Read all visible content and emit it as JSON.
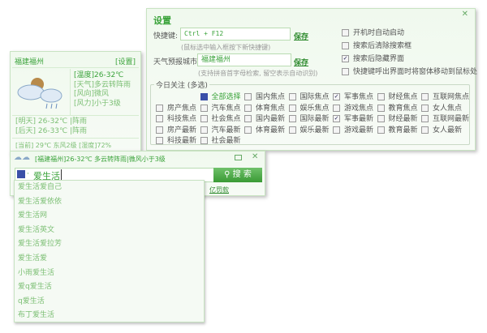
{
  "settings": {
    "title": "设置",
    "close_icon": "close-icon",
    "hotkey_label": "快捷键:",
    "hotkey_value": "Ctrl + F12",
    "hotkey_save": "保存",
    "hotkey_hint": "(鼠标选中输入框按下新快捷键)",
    "city_label": "天气预报城市:",
    "city_value": "福建福州",
    "city_save": "保存",
    "city_hint": "(支持拼音首字母检索, 留空表示自动识别)",
    "options": [
      {
        "label": "开机时自动启动",
        "checked": false
      },
      {
        "label": "搜索后清除搜索框",
        "checked": false
      },
      {
        "label": "搜索后隐藏界面",
        "checked": true
      },
      {
        "label": "快捷键呼出界面时将窗体移动到鼠标处",
        "checked": false
      }
    ],
    "focus_title": "今日关注 (多选)",
    "focus_rows": [
      [
        null,
        {
          "label": "全部选择",
          "checked": "partial"
        },
        {
          "label": "国内焦点",
          "checked": false
        },
        {
          "label": "国际焦点",
          "checked": false
        },
        {
          "label": "军事焦点",
          "checked": true
        },
        {
          "label": "财经焦点",
          "checked": false
        },
        {
          "label": "互联网焦点",
          "checked": false
        }
      ],
      [
        {
          "label": "房产焦点",
          "checked": false
        },
        {
          "label": "汽车焦点",
          "checked": false
        },
        {
          "label": "体育焦点",
          "checked": false
        },
        {
          "label": "娱乐焦点",
          "checked": false
        },
        {
          "label": "游戏焦点",
          "checked": false
        },
        {
          "label": "教育焦点",
          "checked": false
        },
        {
          "label": "女人焦点",
          "checked": false
        }
      ],
      [
        {
          "label": "科技焦点",
          "checked": false
        },
        {
          "label": "社会焦点",
          "checked": false
        },
        {
          "label": "国内最新",
          "checked": false
        },
        {
          "label": "国际最新",
          "checked": false
        },
        {
          "label": "军事最新",
          "checked": true
        },
        {
          "label": "财经最新",
          "checked": false
        },
        {
          "label": "互联网最新",
          "checked": false
        }
      ],
      [
        {
          "label": "房产最新",
          "checked": false
        },
        {
          "label": "汽车最新",
          "checked": false
        },
        {
          "label": "体育最新",
          "checked": false
        },
        {
          "label": "娱乐最新",
          "checked": false
        },
        {
          "label": "游戏最新",
          "checked": false
        },
        {
          "label": "教育最新",
          "checked": false
        },
        {
          "label": "女人最新",
          "checked": false
        }
      ],
      [
        {
          "label": "科技最新",
          "checked": false
        },
        {
          "label": "社会最新",
          "checked": false
        }
      ]
    ]
  },
  "weather": {
    "city": "福建福州",
    "settings_link": "[设置]",
    "temp": "[温度]26-32℃",
    "weather": "[天气]多云转阵雨",
    "wind_dir": "[风向]微风",
    "wind_force": "[风力]小于3级",
    "tomorrow": "[明天] 26-32℃ |阵雨",
    "day_after": "[后天] 26-33℃ |阵雨",
    "current": "[当前] 29℃ 东风2级 [湿度]72%"
  },
  "searchbar": {
    "weather_line": "[福建福州]26-32℃ 多云转阵雨|微风小于3级",
    "engine_icon": "search-engine-icon",
    "query": "爱生活",
    "search_button": "搜 索",
    "behind_link": "亿罚款",
    "suggestions": [
      "爱生活爱自己",
      "爱生活爱依依",
      "爱生活网",
      "爱生活英文",
      "爱生活爱拉芳",
      "爱生活爱",
      "小雨爱生活",
      "爱q爱生活",
      "q爱生活",
      "布丁爱生活"
    ]
  }
}
